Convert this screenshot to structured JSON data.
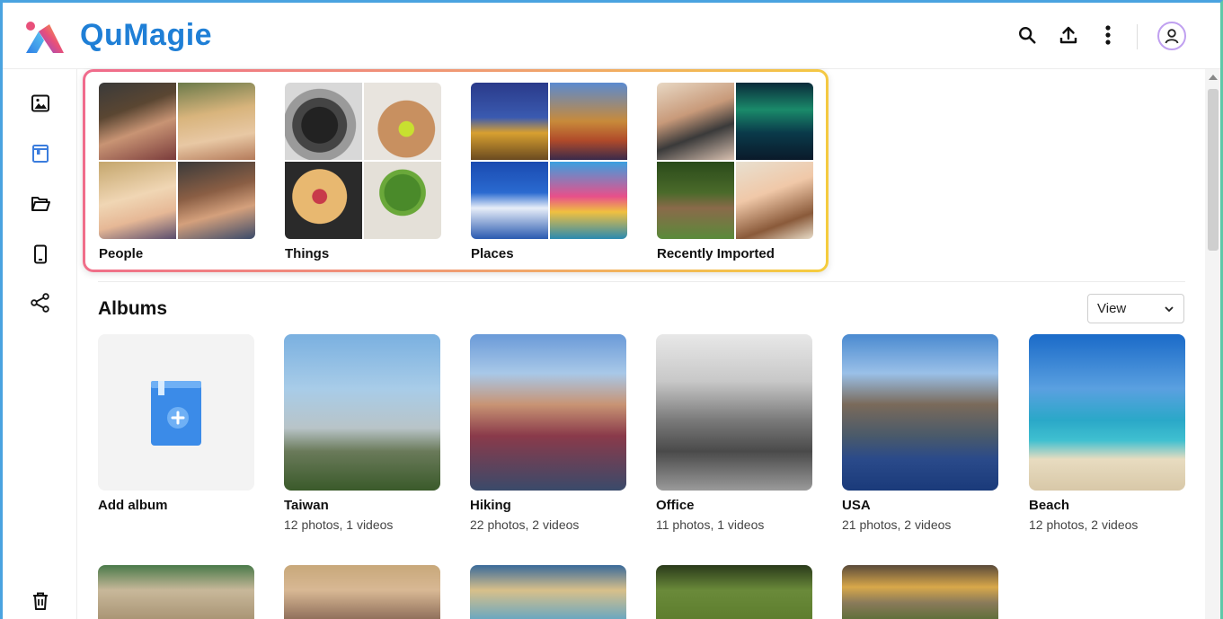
{
  "app": {
    "name": "QuMagie"
  },
  "topbar": {
    "icons": [
      "search-icon",
      "upload-icon",
      "more-vert-icon",
      "user-avatar-icon"
    ]
  },
  "sidebar": {
    "items": [
      {
        "id": "photos",
        "icon": "image-icon"
      },
      {
        "id": "albums",
        "icon": "album-icon",
        "active": true
      },
      {
        "id": "folders",
        "icon": "folder-open-icon"
      },
      {
        "id": "devices",
        "icon": "mobile-icon"
      },
      {
        "id": "sharing",
        "icon": "share-icon"
      },
      {
        "id": "trash",
        "icon": "trash-icon"
      }
    ]
  },
  "categories": [
    {
      "label": "People"
    },
    {
      "label": "Things"
    },
    {
      "label": "Places"
    },
    {
      "label": "Recently Imported"
    }
  ],
  "albums": {
    "title": "Albums",
    "view_label": "View",
    "add_label": "Add album",
    "items": [
      {
        "name": "Taiwan",
        "meta": "12 photos, 1 videos"
      },
      {
        "name": "Hiking",
        "meta": "22 photos, 2 videos"
      },
      {
        "name": "Office",
        "meta": "11 photos, 1 videos"
      },
      {
        "name": "USA",
        "meta": "21 photos, 2 videos"
      },
      {
        "name": "Beach",
        "meta": "12 photos, 2 videos"
      }
    ]
  },
  "colors": {
    "brand": "#1f7fd6",
    "accent_active": "#3b7ddd",
    "highlight_gradient": [
      "#f06a8c",
      "#f0a070",
      "#f5cd3e"
    ]
  }
}
